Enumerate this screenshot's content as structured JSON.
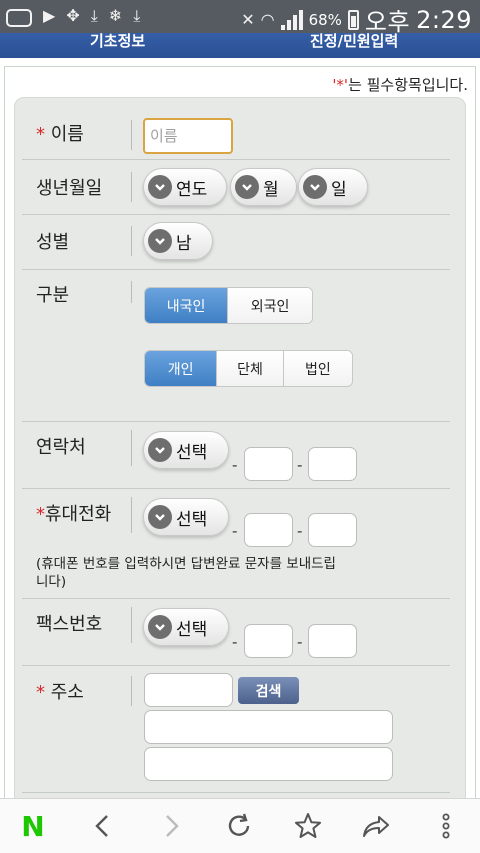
{
  "statusbar": {
    "battery_pct": "68%",
    "ampm": "오후",
    "time": "2:29",
    "icons": [
      "chat-icon",
      "play-icon",
      "dropbox-icon",
      "download-icon",
      "sync-icon",
      "download-icon",
      "mute-icon",
      "wifi-icon",
      "signal-icon",
      "battery-icon"
    ]
  },
  "topnav": {
    "left": "기초정보",
    "right": "진정/민원입력"
  },
  "required_note": {
    "mark": "'*'",
    "text": "는 필수항목입니다."
  },
  "form": {
    "name": {
      "req": "*",
      "label": " 이름",
      "placeholder": "이름"
    },
    "birth": {
      "label": "생년월일",
      "year": "연도",
      "month": "월",
      "day": "일"
    },
    "gender": {
      "label": "성별",
      "value": "남"
    },
    "category": {
      "label": "구분",
      "nationality": [
        "내국인",
        "외국인"
      ],
      "nationality_selected": "내국인",
      "type": [
        "개인",
        "단체",
        "법인"
      ],
      "type_selected": "개인"
    },
    "contact": {
      "label": "연락처",
      "select": "선택"
    },
    "mobile": {
      "req": "*",
      "label": "휴대전화",
      "select": "선택",
      "hint": "(휴대폰 번호를 입력하시면 답변완료 문자를 보내드립니다)"
    },
    "fax": {
      "label": "팩스번호",
      "select": "선택"
    },
    "address": {
      "req": "*",
      "label": " 주소",
      "search": "검색"
    },
    "dash": "-"
  },
  "colors": {
    "accent_blue": "#3f7fc4",
    "required_red": "#d82a2a",
    "nav_blue": "#2a4f93"
  }
}
